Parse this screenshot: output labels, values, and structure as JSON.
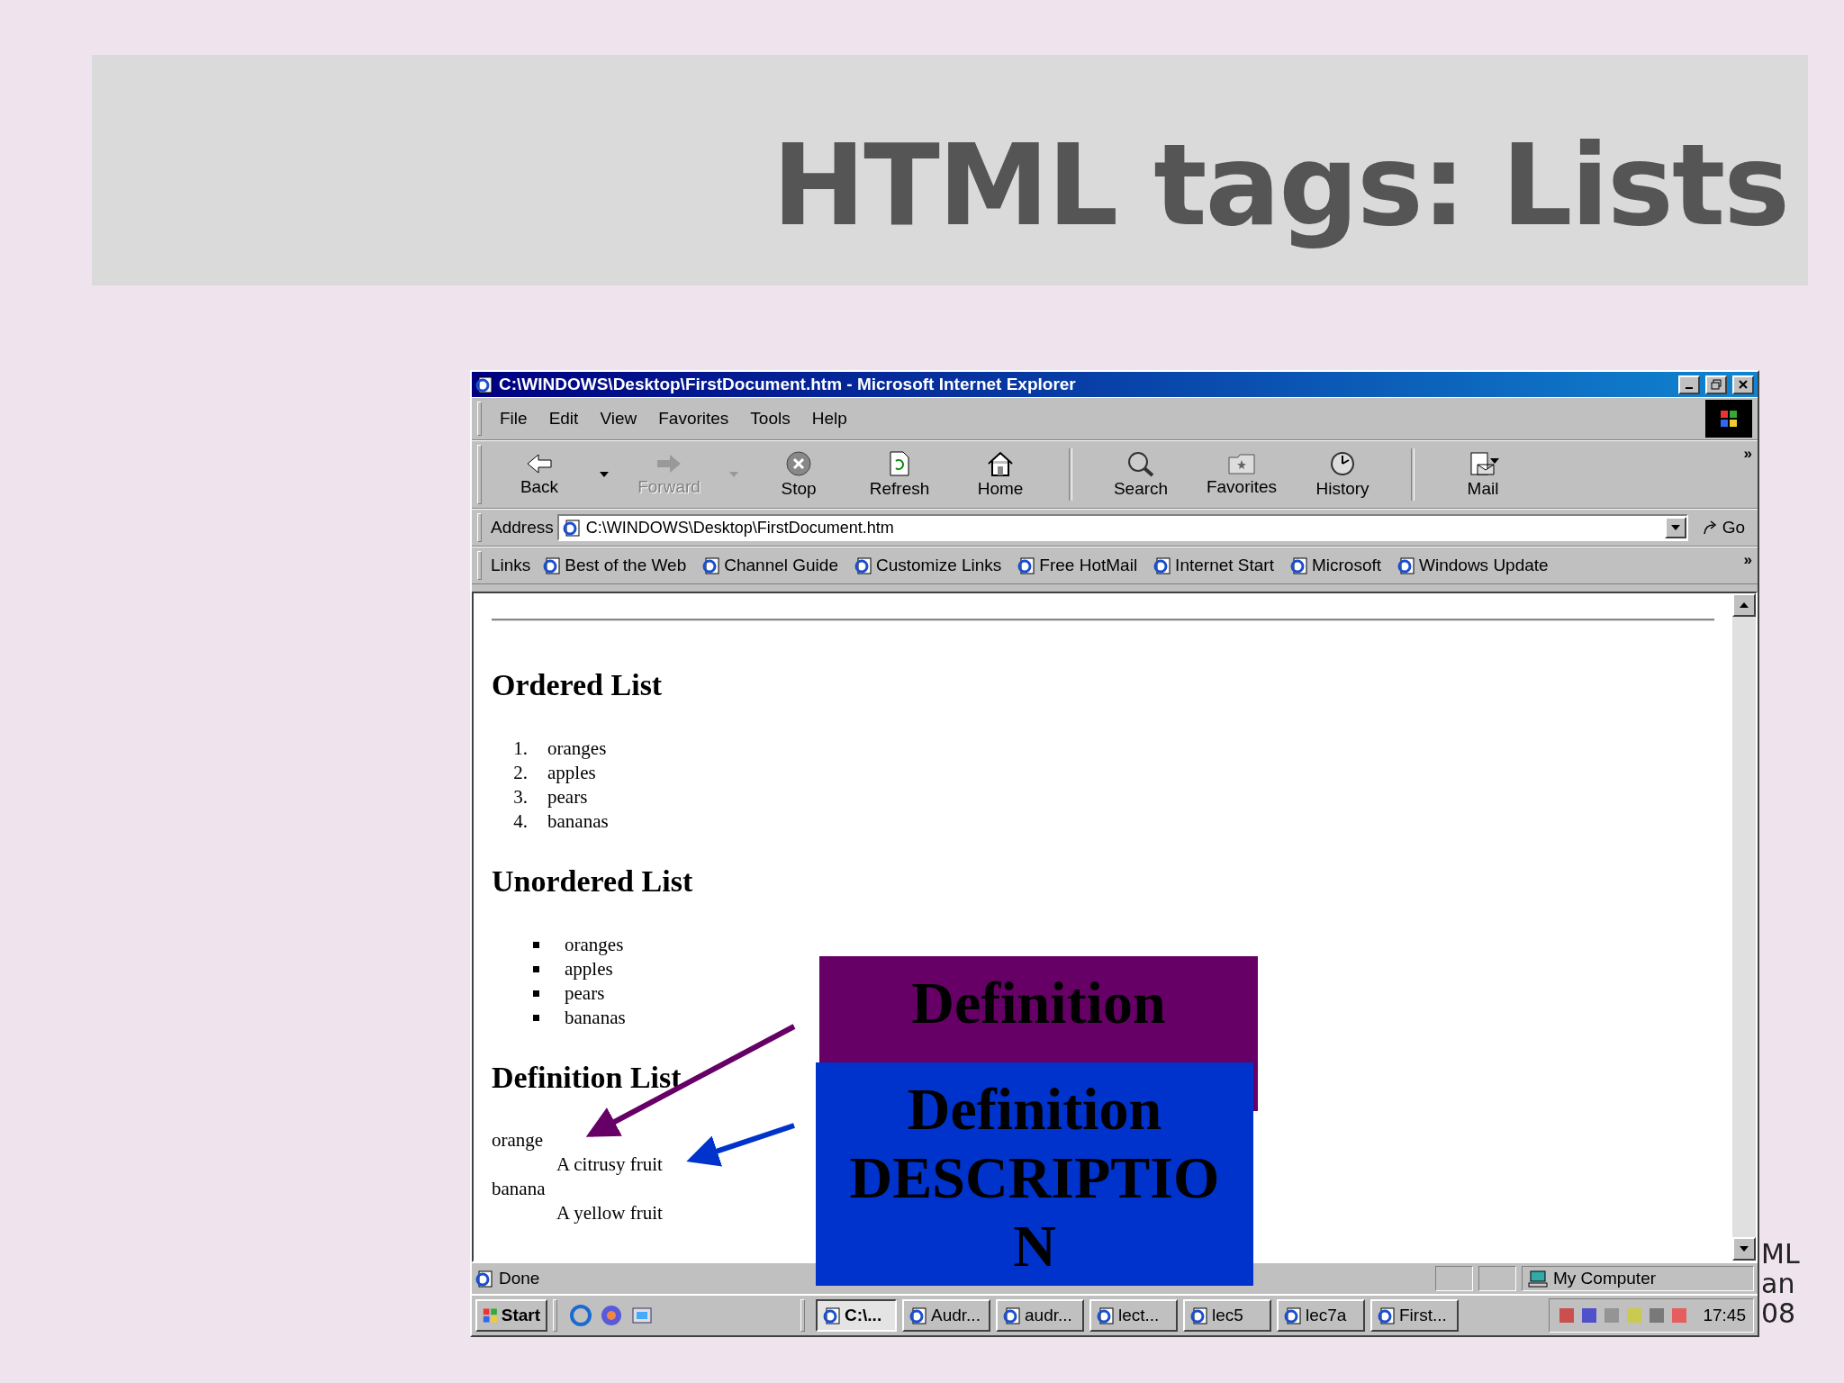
{
  "slide": {
    "title": "HTML tags: Lists",
    "footer_fragments": [
      "ML",
      "an",
      "08"
    ]
  },
  "window": {
    "title": "C:\\WINDOWS\\Desktop\\FirstDocument.htm - Microsoft Internet Explorer"
  },
  "menu": [
    "File",
    "Edit",
    "View",
    "Favorites",
    "Tools",
    "Help"
  ],
  "toolbar": [
    {
      "kind": "back",
      "label": "Back",
      "disabled": false,
      "dropdown": true
    },
    {
      "kind": "forward",
      "label": "Forward",
      "disabled": true,
      "dropdown": true
    },
    {
      "kind": "stop",
      "label": "Stop",
      "disabled": false,
      "dropdown": false
    },
    {
      "kind": "refresh",
      "label": "Refresh",
      "disabled": false,
      "dropdown": false
    },
    {
      "kind": "home",
      "label": "Home",
      "disabled": false,
      "dropdown": false
    },
    {
      "kind": "search",
      "label": "Search",
      "disabled": false,
      "dropdown": false
    },
    {
      "kind": "favorites",
      "label": "Favorites",
      "disabled": false,
      "dropdown": false
    },
    {
      "kind": "history",
      "label": "History",
      "disabled": false,
      "dropdown": false
    },
    {
      "kind": "mail",
      "label": "Mail",
      "disabled": false,
      "dropdown": true
    }
  ],
  "toolbar_more": "»",
  "address": {
    "label": "Address",
    "value": "C:\\WINDOWS\\Desktop\\FirstDocument.htm",
    "go": "Go"
  },
  "links": {
    "label": "Links",
    "items": [
      "Best of the Web",
      "Channel Guide",
      "Customize Links",
      "Free HotMail",
      "Internet Start",
      "Microsoft",
      "Windows Update"
    ],
    "more": "»"
  },
  "content": {
    "sections": [
      {
        "kind": "ordered",
        "heading": "Ordered List",
        "items": [
          {
            "marker": "1.",
            "text": "oranges"
          },
          {
            "marker": "2.",
            "text": "apples"
          },
          {
            "marker": "3.",
            "text": "pears"
          },
          {
            "marker": "4.",
            "text": "bananas"
          }
        ]
      },
      {
        "kind": "unordered",
        "heading": "Unordered List",
        "items": [
          {
            "text": "oranges"
          },
          {
            "text": "apples"
          },
          {
            "text": "pears"
          },
          {
            "text": "bananas"
          }
        ]
      },
      {
        "kind": "definition",
        "heading": "Definition List",
        "items": [
          {
            "term": "orange",
            "description": "A citrusy fruit"
          },
          {
            "term": "banana",
            "description": "A yellow fruit"
          }
        ]
      }
    ]
  },
  "status_bar": {
    "text": "Done",
    "zone": "My Computer"
  },
  "taskbar": {
    "start": "Start",
    "tasks": [
      {
        "label": "C:\\...",
        "selected": true
      },
      {
        "label": "Audr...",
        "selected": false
      },
      {
        "label": "audr...",
        "selected": false
      },
      {
        "label": "lect...",
        "selected": false
      },
      {
        "label": "lec5",
        "selected": false
      },
      {
        "label": "lec7a",
        "selected": false
      },
      {
        "label": "First...",
        "selected": false
      }
    ],
    "clock": "17:45"
  },
  "callouts": [
    {
      "kind": "title",
      "color": "#660066",
      "lines": [
        "Definition"
      ]
    },
    {
      "kind": "description",
      "color": "#0033cc",
      "lines": [
        "Definition",
        "DESCRIPTIO",
        "N"
      ]
    }
  ]
}
